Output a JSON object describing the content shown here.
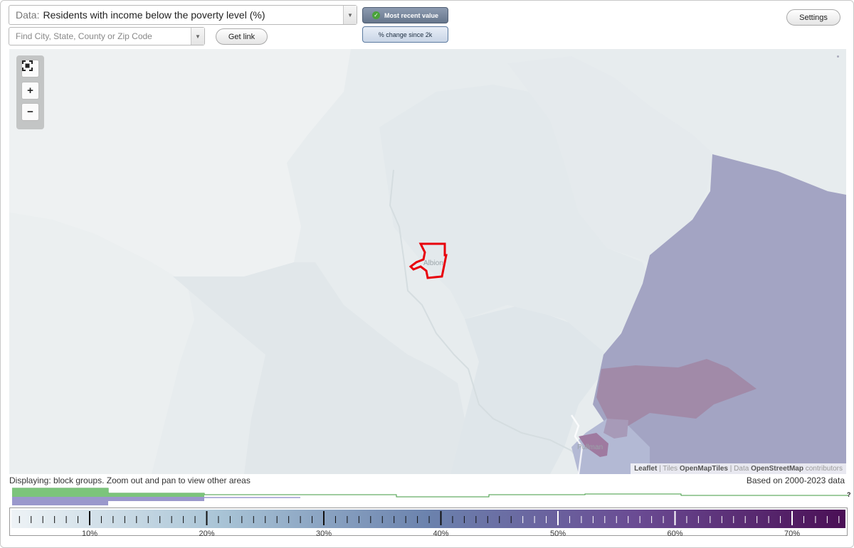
{
  "data_select": {
    "prefix": "Data:",
    "value": "Residents with income below the poverty level (%)"
  },
  "search": {
    "placeholder": "Find City, State, County or Zip Code"
  },
  "buttons": {
    "get_link": "Get link",
    "settings": "Settings",
    "most_recent": "Most recent value",
    "percent_change": "% change since 2k"
  },
  "icons": {
    "dropdown": "chevron-down-icon",
    "check": "check-icon",
    "fullscreen": "fullscreen-icon",
    "zoom_in": "plus-icon",
    "zoom_out": "minus-icon"
  },
  "map": {
    "place_labels": [
      "Albion",
      "Pullman"
    ],
    "attribution": {
      "leaflet": "Leaflet",
      "tiles_prefix": "Tiles",
      "tiles": "OpenMapTiles",
      "data_prefix": "Data",
      "data_source": "OpenStreetMap",
      "data_suffix": "contributors"
    },
    "highlight_color": "#e8000b"
  },
  "footer": {
    "displaying": "Displaying: block groups. Zoom out and pan to view other areas",
    "based_on": "Based on 2000-2023 data",
    "help": "?"
  },
  "legend": {
    "ticks": [
      "10%",
      "20%",
      "30%",
      "40%",
      "50%",
      "60%",
      "70%"
    ],
    "gradient_colors": [
      "#eef3f6",
      "#a9c4d6",
      "#6b82ad",
      "#6a4b93",
      "#4a0f55"
    ],
    "histogram_colors": {
      "green": "#7cc47b",
      "purple": "#9a98cc"
    }
  }
}
